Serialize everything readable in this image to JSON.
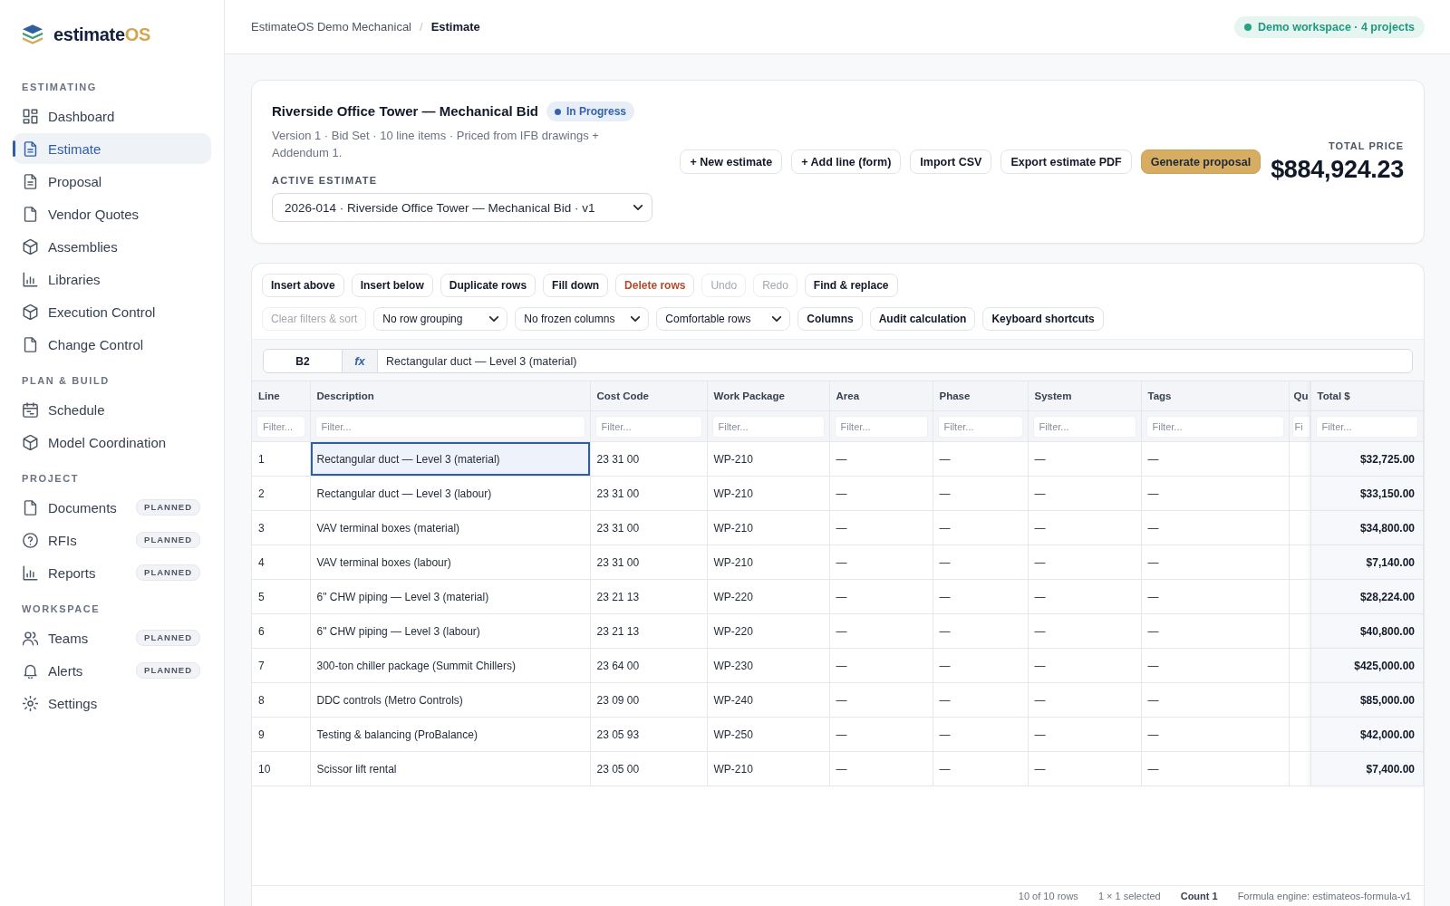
{
  "logo": {
    "name": "estimate",
    "suffix": "OS"
  },
  "sidebar": {
    "sections": [
      {
        "title": "ESTIMATING",
        "items": [
          {
            "label": "Dashboard",
            "selected": false
          },
          {
            "label": "Estimate",
            "selected": true
          },
          {
            "label": "Proposal",
            "selected": false
          },
          {
            "label": "Vendor Quotes",
            "selected": false
          },
          {
            "label": "Assemblies",
            "selected": false
          },
          {
            "label": "Libraries",
            "selected": false
          },
          {
            "label": "Execution Control",
            "selected": false
          },
          {
            "label": "Change Control",
            "selected": false
          }
        ]
      },
      {
        "title": "PLAN & BUILD",
        "items": [
          {
            "label": "Schedule",
            "selected": false
          },
          {
            "label": "Model Coordination",
            "selected": false
          }
        ]
      },
      {
        "title": "PROJECT",
        "items": [
          {
            "label": "Documents",
            "selected": false,
            "badge": "PLANNED"
          },
          {
            "label": "RFIs",
            "selected": false,
            "badge": "PLANNED"
          },
          {
            "label": "Reports",
            "selected": false,
            "badge": "PLANNED"
          }
        ]
      },
      {
        "title": "WORKSPACE",
        "items": [
          {
            "label": "Teams",
            "selected": false,
            "badge": "PLANNED"
          },
          {
            "label": "Alerts",
            "selected": false,
            "badge": "PLANNED"
          },
          {
            "label": "Settings",
            "selected": false
          }
        ]
      }
    ]
  },
  "topbar": {
    "breadcrumb": {
      "items": [
        "EstimateOS Demo Mechanical",
        "Estimate"
      ],
      "separator": "/"
    },
    "workspace_badge": "Demo workspace · 4 projects"
  },
  "estimate_header": {
    "title": "Riverside Office Tower — Mechanical Bid",
    "status": {
      "label": "In Progress",
      "kind": "in_progress"
    },
    "subtitle": "Version 1 · Bid Set · 10 line items · Priced from IFB drawings + Addendum 1.",
    "active_estimate_label": "ACTIVE ESTIMATE",
    "active_estimate": "2026-014 · Riverside Office Tower — Mechanical Bid · v1",
    "actions": [
      {
        "label": "+ New estimate",
        "kind": "default"
      },
      {
        "label": "+ Add line (form)",
        "kind": "default"
      },
      {
        "label": "Import CSV",
        "kind": "default"
      },
      {
        "label": "Export estimate PDF",
        "kind": "default"
      },
      {
        "label": "Generate proposal",
        "kind": "primary"
      }
    ],
    "total_label": "TOTAL PRICE",
    "total": "$884,924.23"
  },
  "grid": {
    "toolbar_rows": [
      [
        {
          "kind": "button",
          "label": "Insert above",
          "disabled": false
        },
        {
          "kind": "button",
          "label": "Insert below",
          "disabled": false
        },
        {
          "kind": "button",
          "label": "Duplicate rows",
          "disabled": false
        },
        {
          "kind": "button",
          "label": "Fill down",
          "disabled": false
        },
        {
          "kind": "danger",
          "label": "Delete rows",
          "disabled": false
        },
        {
          "kind": "button",
          "label": "Undo",
          "disabled": true
        },
        {
          "kind": "button",
          "label": "Redo",
          "disabled": true
        },
        {
          "kind": "button",
          "label": "Find & replace",
          "disabled": false
        }
      ],
      [
        {
          "kind": "button",
          "label": "Clear filters & sort",
          "disabled": true
        },
        {
          "kind": "select",
          "label": "No row grouping",
          "disabled": false
        },
        {
          "kind": "select",
          "label": "No frozen columns",
          "disabled": false
        },
        {
          "kind": "select",
          "label": "Comfortable rows",
          "disabled": false
        },
        {
          "kind": "button",
          "label": "Columns",
          "disabled": false
        },
        {
          "kind": "button",
          "label": "Audit calculation",
          "disabled": false
        },
        {
          "kind": "button",
          "label": "Keyboard shortcuts",
          "disabled": false
        }
      ]
    ],
    "formula_bar": {
      "cell_ref": "B2",
      "fx_label": "fx",
      "value": "Rectangular duct — Level 3 (material)"
    },
    "columns": [
      {
        "label": "Line",
        "filter_placeholder": "Filter..."
      },
      {
        "label": "Description",
        "filter_placeholder": "Filter..."
      },
      {
        "label": "Cost Code",
        "filter_placeholder": "Filter..."
      },
      {
        "label": "Work Package",
        "filter_placeholder": "Filter..."
      },
      {
        "label": "Area",
        "filter_placeholder": "Filter..."
      },
      {
        "label": "Phase",
        "filter_placeholder": "Filter..."
      },
      {
        "label": "System",
        "filter_placeholder": "Filter..."
      },
      {
        "label": "Tags",
        "filter_placeholder": "Filter..."
      },
      {
        "label": "Qu",
        "filter_placeholder": "Fi"
      },
      {
        "label": "Total $",
        "filter_placeholder": "Filter..."
      }
    ],
    "rows": [
      {
        "line": "1",
        "description": "Rectangular duct — Level 3 (material)",
        "cost_code": "23 31 00",
        "work_package": "WP-210",
        "area": "—",
        "phase": "—",
        "system": "—",
        "tags": "—",
        "total": "$32,725.00",
        "selected": true
      },
      {
        "line": "2",
        "description": "Rectangular duct — Level 3 (labour)",
        "cost_code": "23 31 00",
        "work_package": "WP-210",
        "area": "—",
        "phase": "—",
        "system": "—",
        "tags": "—",
        "total": "$33,150.00",
        "selected": false
      },
      {
        "line": "3",
        "description": "VAV terminal boxes (material)",
        "cost_code": "23 31 00",
        "work_package": "WP-210",
        "area": "—",
        "phase": "—",
        "system": "—",
        "tags": "—",
        "total": "$34,800.00",
        "selected": false
      },
      {
        "line": "4",
        "description": "VAV terminal boxes (labour)",
        "cost_code": "23 31 00",
        "work_package": "WP-210",
        "area": "—",
        "phase": "—",
        "system": "—",
        "tags": "—",
        "total": "$7,140.00",
        "selected": false
      },
      {
        "line": "5",
        "description": "6\" CHW piping — Level 3 (material)",
        "cost_code": "23 21 13",
        "work_package": "WP-220",
        "area": "—",
        "phase": "—",
        "system": "—",
        "tags": "—",
        "total": "$28,224.00",
        "selected": false
      },
      {
        "line": "6",
        "description": "6\" CHW piping — Level 3 (labour)",
        "cost_code": "23 21 13",
        "work_package": "WP-220",
        "area": "—",
        "phase": "—",
        "system": "—",
        "tags": "—",
        "total": "$40,800.00",
        "selected": false
      },
      {
        "line": "7",
        "description": "300-ton chiller package (Summit Chillers)",
        "cost_code": "23 64 00",
        "work_package": "WP-230",
        "area": "—",
        "phase": "—",
        "system": "—",
        "tags": "—",
        "total": "$425,000.00",
        "selected": false
      },
      {
        "line": "8",
        "description": "DDC controls (Metro Controls)",
        "cost_code": "23 09 00",
        "work_package": "WP-240",
        "area": "—",
        "phase": "—",
        "system": "—",
        "tags": "—",
        "total": "$85,000.00",
        "selected": false
      },
      {
        "line": "9",
        "description": "Testing & balancing (ProBalance)",
        "cost_code": "23 05 93",
        "work_package": "WP-250",
        "area": "—",
        "phase": "—",
        "system": "—",
        "tags": "—",
        "total": "$42,000.00",
        "selected": false
      },
      {
        "line": "10",
        "description": "Scissor lift rental",
        "cost_code": "23 05 00",
        "work_package": "WP-210",
        "area": "—",
        "phase": "—",
        "system": "—",
        "tags": "—",
        "total": "$7,400.00",
        "selected": false
      }
    ],
    "status_bar": [
      {
        "text": "10 of 10 rows",
        "emphasis": false
      },
      {
        "text": "1 × 1 selected",
        "emphasis": false
      },
      {
        "text": "Count 1",
        "emphasis": true
      },
      {
        "text": "Formula engine: estimateos-formula-v1",
        "emphasis": false
      }
    ]
  }
}
